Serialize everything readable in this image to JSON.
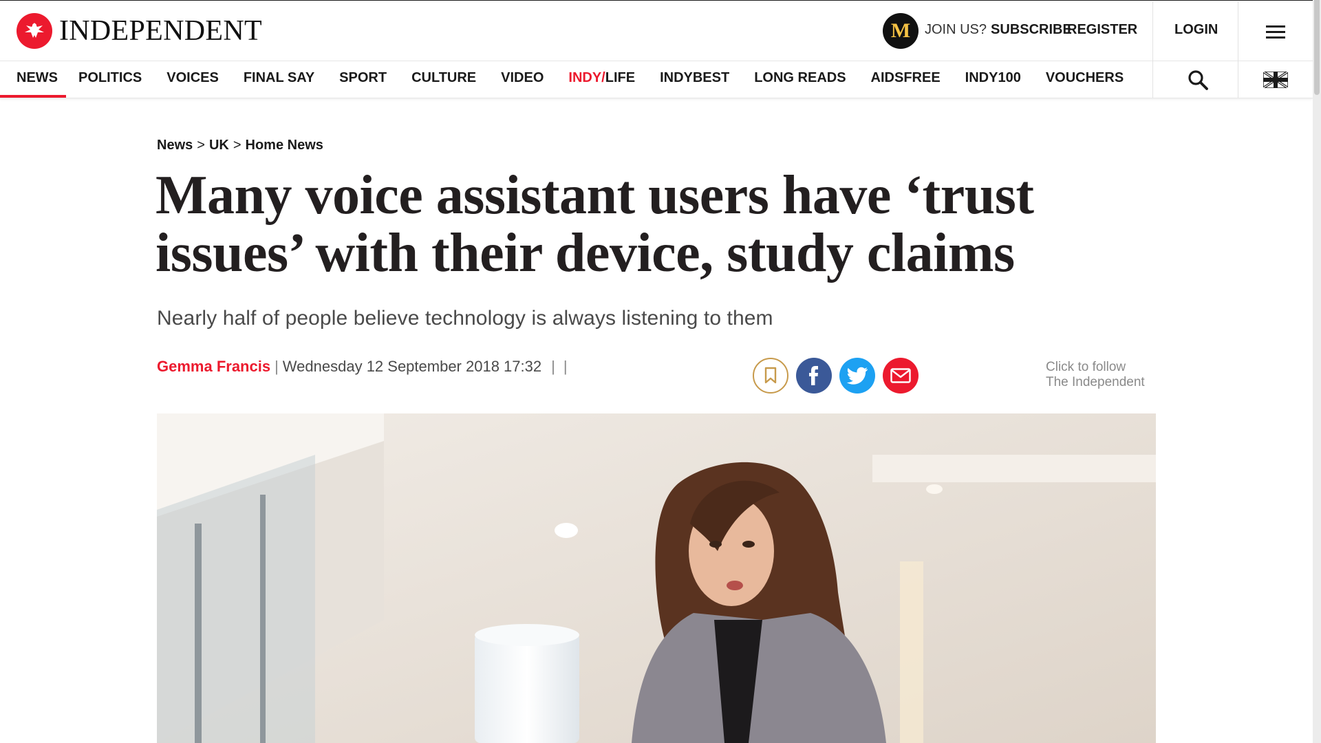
{
  "brand": {
    "name": "INDEPENDENT",
    "badge_letter": "M"
  },
  "account": {
    "join_us": "JOIN US?",
    "subscribe": "SUBSCRIBE",
    "register": "REGISTER",
    "login": "LOGIN"
  },
  "nav": {
    "items": [
      {
        "label": "NEWS",
        "active": true
      },
      {
        "label": "POLITICS"
      },
      {
        "label": "VOICES"
      },
      {
        "label": "FINAL SAY"
      },
      {
        "label": "SPORT"
      },
      {
        "label": "CULTURE"
      },
      {
        "label": "VIDEO"
      },
      {
        "label_red": "INDY/",
        "label_rest": "LIFE"
      },
      {
        "label": "INDYBEST"
      },
      {
        "label": "LONG READS"
      },
      {
        "label": "AIDSFREE"
      },
      {
        "label": "INDY100"
      },
      {
        "label": "VOUCHERS"
      }
    ],
    "search_icon": "search-icon",
    "flag_icon": "uk-flag-icon"
  },
  "article": {
    "breadcrumb": [
      "News",
      "UK",
      "Home News"
    ],
    "breadcrumb_sep": ">",
    "headline": "Many voice assistant users have ‘trust issues’ with their device, study claims",
    "standfirst": "Nearly half of people believe technology is always listening to them",
    "author": "Gemma Francis",
    "date": "Wednesday 12 September 2018 17:32",
    "byline_sep": "|"
  },
  "share": {
    "icons": [
      "bookmark-icon",
      "facebook-icon",
      "twitter-icon",
      "email-icon"
    ]
  },
  "follow": {
    "line1": "Click to follow",
    "line2": "The Independent"
  },
  "colors": {
    "brand_red": "#ec1a2e",
    "facebook": "#3b5998",
    "twitter": "#1da1f2",
    "bookmark_gold": "#c79a4b",
    "m_badge_gold": "#f5c244"
  }
}
